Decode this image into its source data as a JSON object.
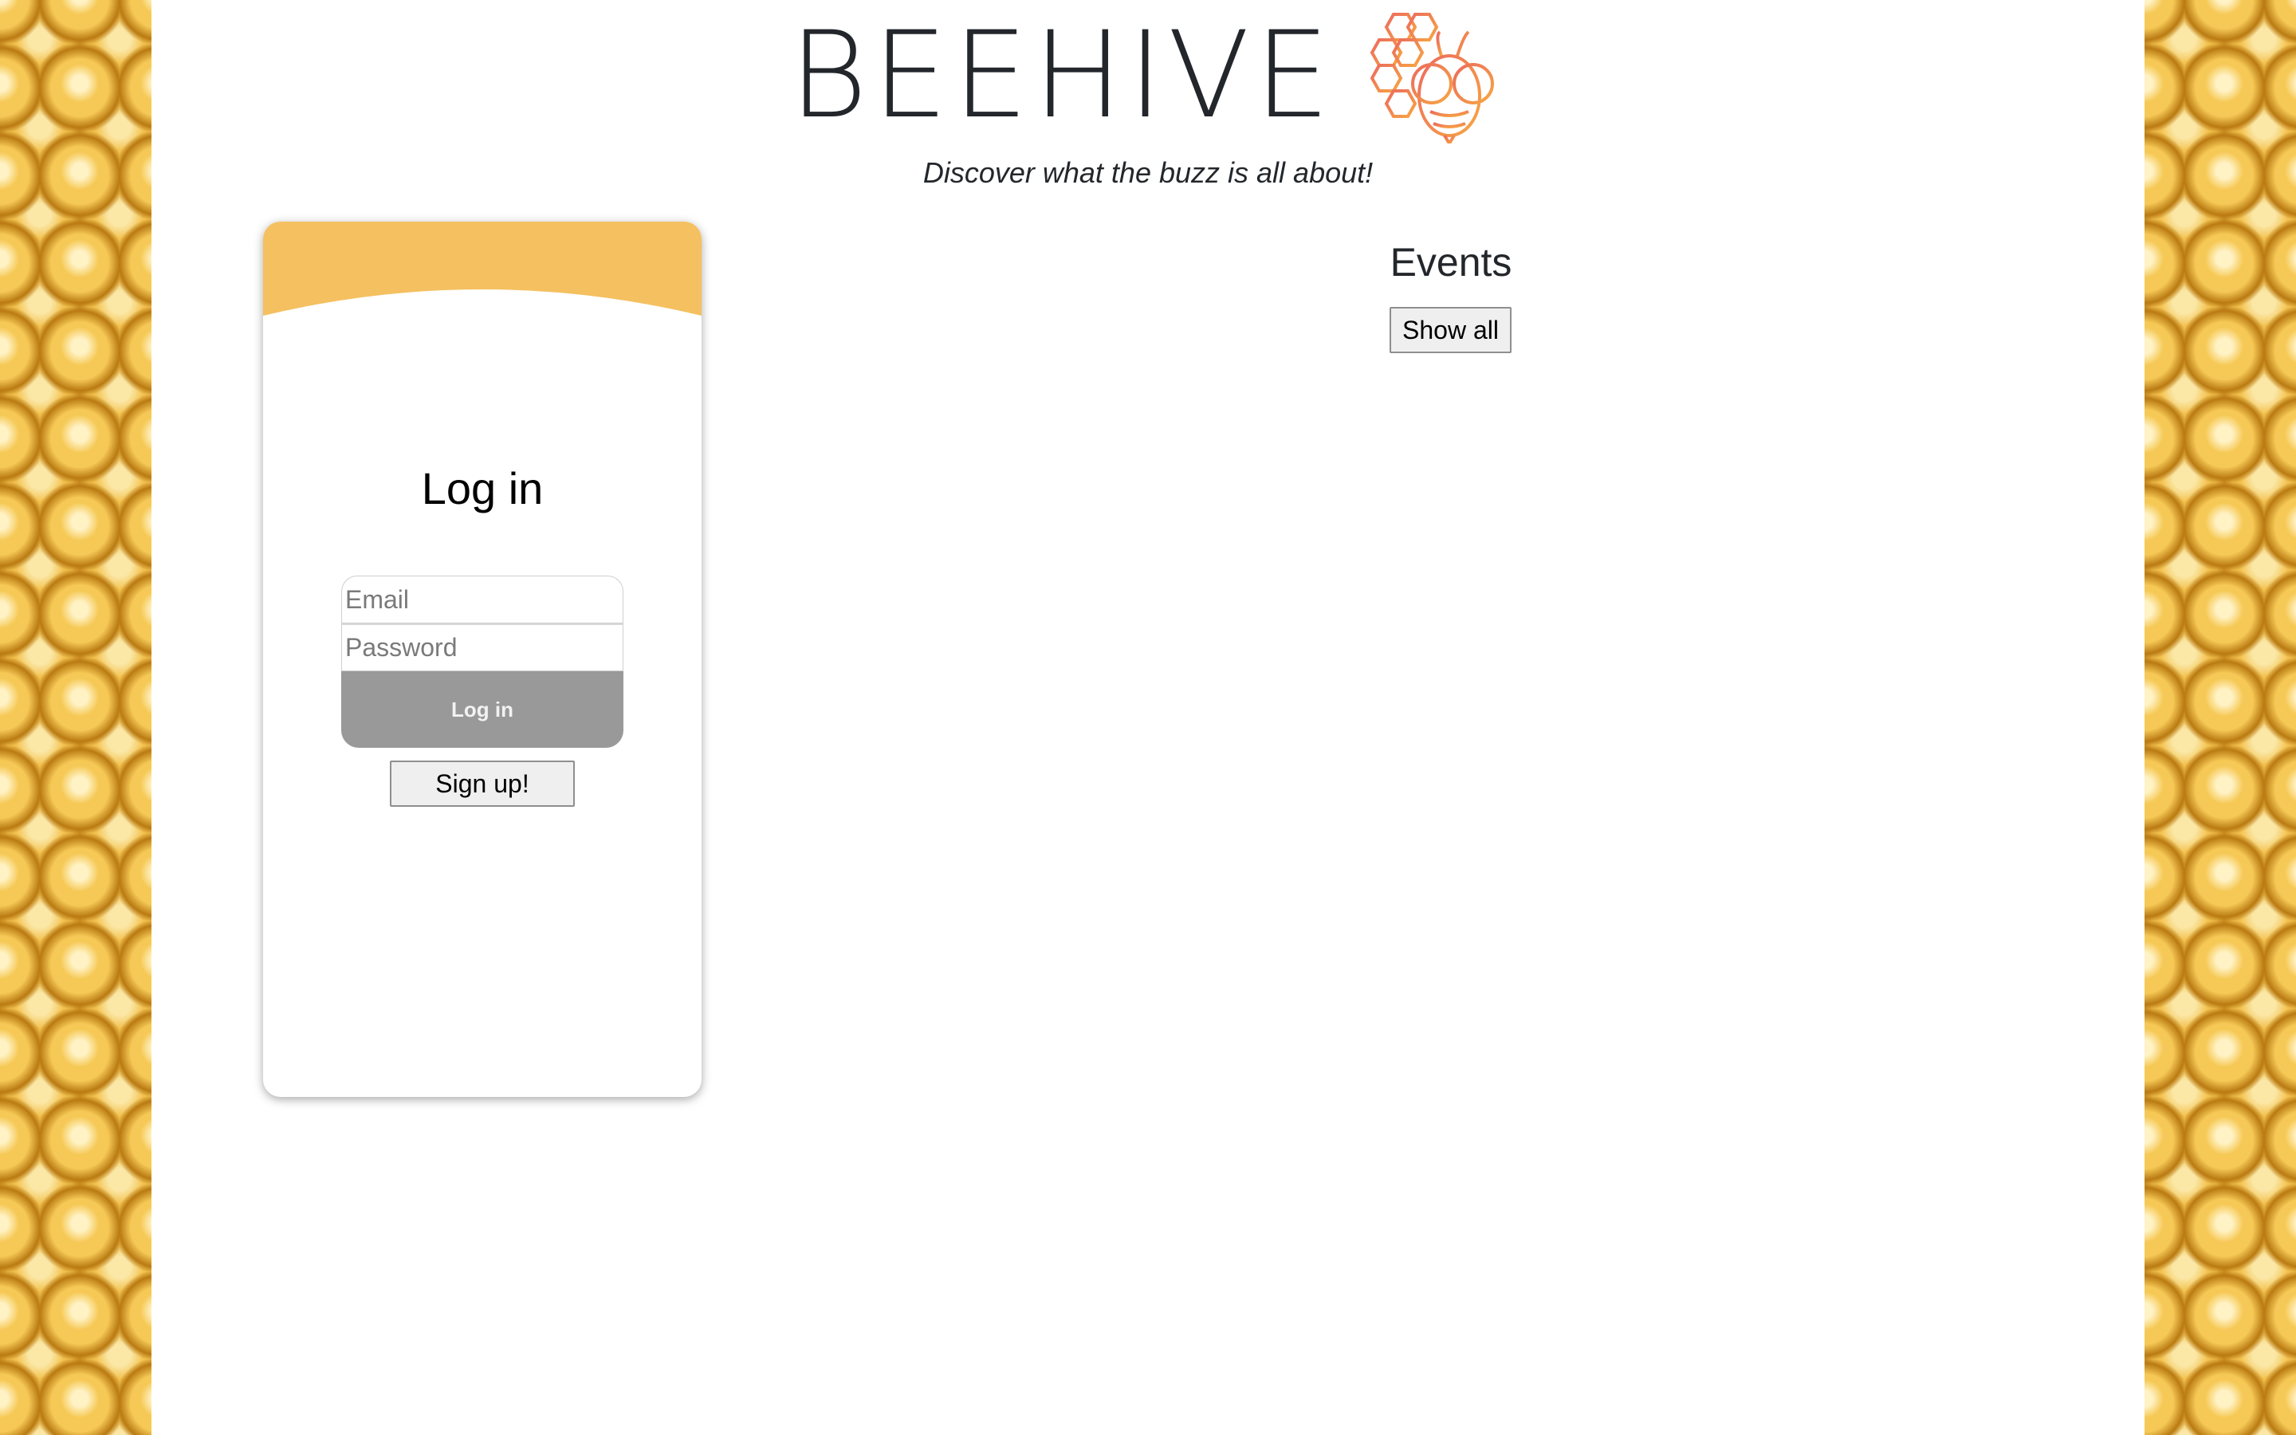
{
  "header": {
    "title": "BEEHIVE",
    "logo_icon": "bee-honeycomb-icon",
    "tagline": "Discover what the buzz is all about!"
  },
  "login_card": {
    "title": "Log in",
    "email_placeholder": "Email",
    "email_value": "",
    "password_placeholder": "Password",
    "password_value": "",
    "login_label": "Log in",
    "signup_label": "Sign up!"
  },
  "events": {
    "title": "Events",
    "show_all_label": "Show all"
  },
  "colors": {
    "accent": "#f5c060",
    "logo_gradient_start": "#ec6a5e",
    "logo_gradient_end": "#f7a642",
    "login_button": "#999999",
    "text": "#23272b",
    "honeycomb": "#e2a934"
  }
}
